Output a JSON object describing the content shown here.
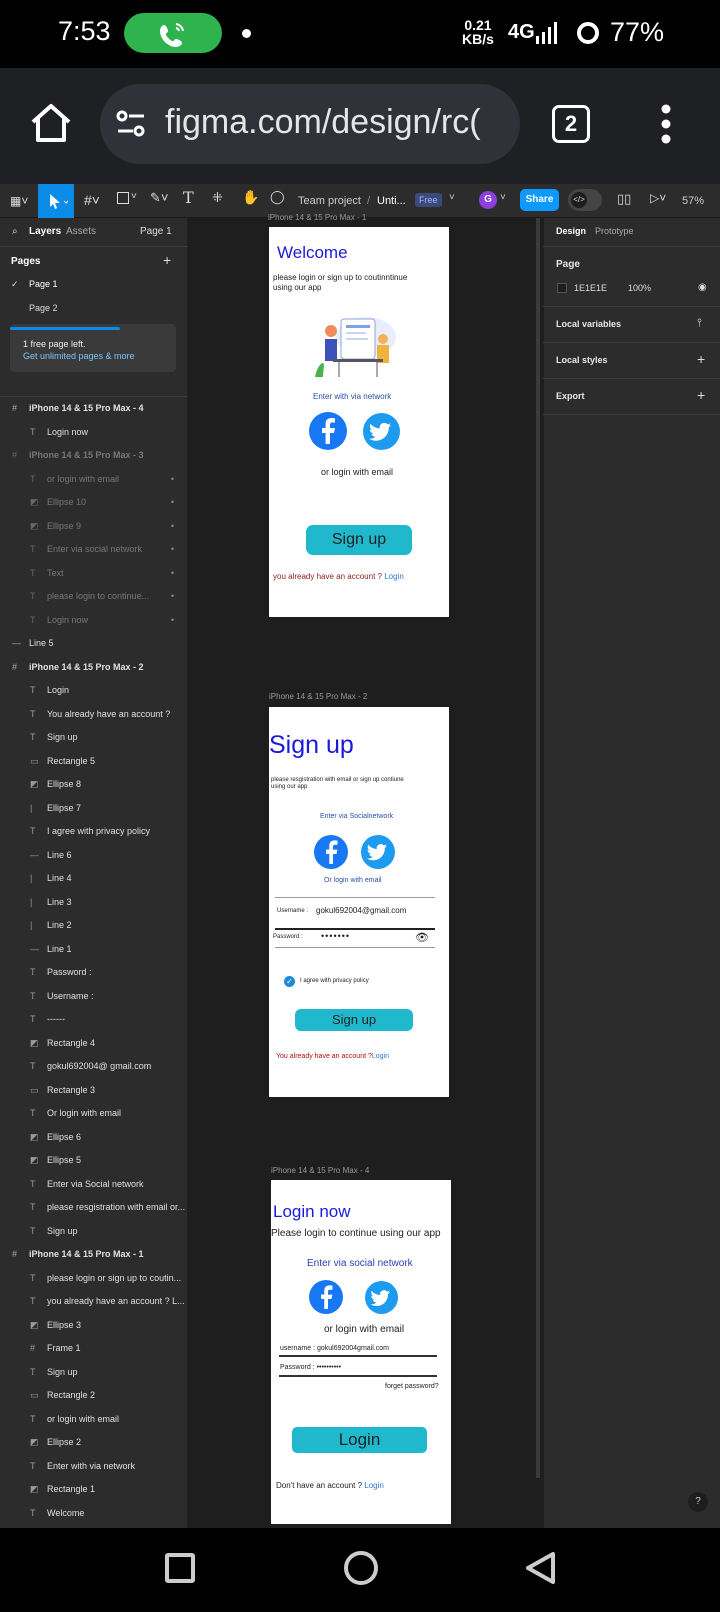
{
  "status_bar": {
    "time": "7:53",
    "speed": "0.21",
    "speed_unit": "KB/s",
    "network": "4G",
    "battery": "77%"
  },
  "browser": {
    "url": "figma.com/design/rc(",
    "tab_count": "2"
  },
  "toolbar": {
    "team": "Team project",
    "separator": "/",
    "file": "Unti...",
    "plan_badge": "Free",
    "avatar_initial": "G",
    "share_label": "Share",
    "zoom": "57%"
  },
  "left_panel": {
    "tab_layers": "Layers",
    "tab_assets": "Assets",
    "page_selector": "Page 1",
    "pages_heading": "Pages",
    "pages": [
      "Page 1",
      "Page 2"
    ],
    "notice_title": "1 free page left.",
    "notice_link": "Get unlimited pages & more",
    "layers": [
      {
        "icon": "#",
        "label": "iPhone 14 & 15 Pro Max - 4",
        "kind": "frame"
      },
      {
        "icon": "T",
        "label": "Login now",
        "kind": "child"
      },
      {
        "icon": "#",
        "label": "iPhone 14 & 15 Pro Max - 3",
        "kind": "frame-dim"
      },
      {
        "icon": "T",
        "label": "or login with email",
        "kind": "dim"
      },
      {
        "icon": "◩",
        "label": "Ellipse 10",
        "kind": "dim"
      },
      {
        "icon": "◩",
        "label": "Ellipse 9",
        "kind": "dim"
      },
      {
        "icon": "T",
        "label": "Enter via social network",
        "kind": "dim"
      },
      {
        "icon": "T",
        "label": "Text",
        "kind": "dim"
      },
      {
        "icon": "T",
        "label": "please login to continue...",
        "kind": "dim"
      },
      {
        "icon": "T",
        "label": "Login now",
        "kind": "dim"
      },
      {
        "icon": "—",
        "label": "Line 5",
        "kind": "top"
      },
      {
        "icon": "#",
        "label": "iPhone 14 & 15 Pro Max - 2",
        "kind": "frame"
      },
      {
        "icon": "T",
        "label": "Login",
        "kind": "child"
      },
      {
        "icon": "T",
        "label": "You already have an account ?",
        "kind": "child"
      },
      {
        "icon": "T",
        "label": "Sign up",
        "kind": "child"
      },
      {
        "icon": "▭",
        "label": "Rectangle 5",
        "kind": "child"
      },
      {
        "icon": "◩",
        "label": "Ellipse 8",
        "kind": "child"
      },
      {
        "icon": "|",
        "label": "Ellipse 7",
        "kind": "child"
      },
      {
        "icon": "T",
        "label": "I agree with privacy policy",
        "kind": "child"
      },
      {
        "icon": "—",
        "label": "Line 6",
        "kind": "child"
      },
      {
        "icon": "|",
        "label": "Line 4",
        "kind": "child"
      },
      {
        "icon": "|",
        "label": "Line 3",
        "kind": "child"
      },
      {
        "icon": "|",
        "label": "Line 2",
        "kind": "child"
      },
      {
        "icon": "—",
        "label": "Line 1",
        "kind": "child"
      },
      {
        "icon": "T",
        "label": "Password :",
        "kind": "child"
      },
      {
        "icon": "T",
        "label": "Username :",
        "kind": "child"
      },
      {
        "icon": "T",
        "label": "------",
        "kind": "child"
      },
      {
        "icon": "◩",
        "label": "Rectangle 4",
        "kind": "child"
      },
      {
        "icon": "T",
        "label": "gokul692004@ gmail.com",
        "kind": "child"
      },
      {
        "icon": "▭",
        "label": "Rectangle 3",
        "kind": "child"
      },
      {
        "icon": "T",
        "label": "Or login with email",
        "kind": "child"
      },
      {
        "icon": "◩",
        "label": "Ellipse 6",
        "kind": "child"
      },
      {
        "icon": "◩",
        "label": "Ellipse 5",
        "kind": "child"
      },
      {
        "icon": "T",
        "label": "Enter via Social network",
        "kind": "child"
      },
      {
        "icon": "T",
        "label": "please resgistration with email or...",
        "kind": "child"
      },
      {
        "icon": "T",
        "label": "Sign up",
        "kind": "child"
      },
      {
        "icon": "#",
        "label": "iPhone 14 & 15 Pro Max - 1",
        "kind": "frame"
      },
      {
        "icon": "T",
        "label": "please login or sign up to coutin...",
        "kind": "child"
      },
      {
        "icon": "T",
        "label": "you already have an account ? L...",
        "kind": "child"
      },
      {
        "icon": "◩",
        "label": "Ellipse 3",
        "kind": "child"
      },
      {
        "icon": "#",
        "label": "Frame 1",
        "kind": "child"
      },
      {
        "icon": "T",
        "label": "Sign up",
        "kind": "child"
      },
      {
        "icon": "▭",
        "label": "Rectangle 2",
        "kind": "child"
      },
      {
        "icon": "T",
        "label": "or login with email",
        "kind": "child"
      },
      {
        "icon": "◩",
        "label": "Ellipse 2",
        "kind": "child"
      },
      {
        "icon": "T",
        "label": "Enter with via network",
        "kind": "child"
      },
      {
        "icon": "◩",
        "label": "Rectangle 1",
        "kind": "child"
      },
      {
        "icon": "T",
        "label": "Welcome",
        "kind": "child"
      }
    ]
  },
  "canvas": {
    "frame1": {
      "label": "iPhone 14 & 15 Pro Max - 1",
      "title": "Welcome",
      "subtitle_line1": "please login or sign up to coutinntinue",
      "subtitle_line2": "using our app",
      "social": "Enter with via network",
      "email": "or login with  email",
      "button": "Sign up",
      "footer": "you  already have an account ?",
      "footer_link": "Login"
    },
    "frame2": {
      "label": "iPhone 14 & 15 Pro Max - 2",
      "title": "Sign up",
      "subtitle_line1": "please resgistration  with email or  sign up contiune",
      "subtitle_line2": "using our app",
      "social": "Enter  via  Socialnetwork",
      "email": "Or login with email",
      "username_label": "Username :",
      "username_value": "gokul692004@gmail.com",
      "password_label": "Password  :",
      "password_value": "•••••••",
      "privacy": "I agree with privacy policy",
      "button": "Sign up",
      "footer": "You already have an account ?",
      "footer_link": "Login"
    },
    "frame4": {
      "label": "iPhone 14 & 15 Pro Max - 4",
      "title": "Login now",
      "subtitle": "Please login to continue using our app",
      "social": "Enter via social network",
      "email": "or login with email",
      "username": "username :  gokul692004gmail.com",
      "password": "Password  :  ••••••••••",
      "forgot": "forget password?",
      "button": "Login",
      "footer": "Don't have an account ?",
      "footer_link": "Login"
    }
  },
  "right_panel": {
    "tab_design": "Design",
    "tab_prototype": "Prototype",
    "page_heading": "Page",
    "bg_hex": "1E1E1E",
    "bg_opacity": "100%",
    "local_variables": "Local variables",
    "local_styles": "Local styles",
    "export": "Export",
    "help": "?"
  },
  "colors": {
    "accent": "#0c8ce9",
    "button_teal": "#1fb8cc",
    "facebook": "#1877f2",
    "twitter": "#1d9bf0",
    "title_blue": "#1a1adc"
  }
}
